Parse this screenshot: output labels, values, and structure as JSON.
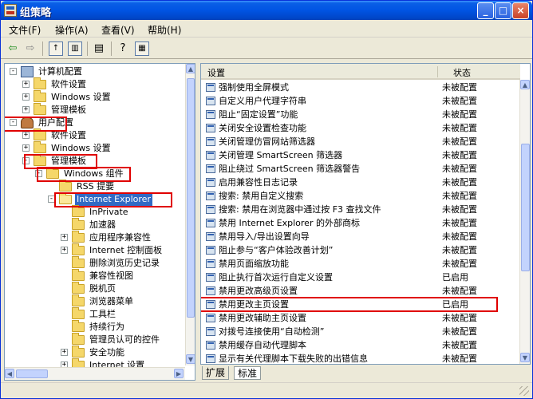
{
  "window": {
    "title": "组策略"
  },
  "menu": [
    "文件(F)",
    "操作(A)",
    "查看(V)",
    "帮助(H)"
  ],
  "tree": [
    {
      "label": "计算机配置",
      "indent": 0,
      "icon": "computer-icon",
      "exp": "−",
      "name": "tree-item-computer-config"
    },
    {
      "label": "软件设置",
      "indent": 1,
      "icon": "folder-icon",
      "exp": "+",
      "name": "tree-item-software-settings"
    },
    {
      "label": "Windows 设置",
      "indent": 1,
      "icon": "folder-icon",
      "exp": "+",
      "name": "tree-item-windows-settings"
    },
    {
      "label": "管理模板",
      "indent": 1,
      "icon": "folder-icon",
      "exp": "+",
      "name": "tree-item-admin-templates"
    },
    {
      "label": "用户配置",
      "indent": 0,
      "icon": "user-icon",
      "exp": "−",
      "name": "tree-item-user-config"
    },
    {
      "label": "软件设置",
      "indent": 1,
      "icon": "folder-icon",
      "exp": "+",
      "name": "tree-item-user-software-settings"
    },
    {
      "label": "Windows 设置",
      "indent": 1,
      "icon": "folder-icon",
      "exp": "+",
      "name": "tree-item-user-windows-settings"
    },
    {
      "label": "管理模板",
      "indent": 1,
      "icon": "folder-icon",
      "exp": "−",
      "name": "tree-item-user-admin-templates"
    },
    {
      "label": "Windows 组件",
      "indent": 2,
      "icon": "folder-icon",
      "exp": "−",
      "name": "tree-item-windows-components"
    },
    {
      "label": "RSS 提要",
      "indent": 3,
      "icon": "folder-icon",
      "exp": "",
      "name": "tree-item-rss"
    },
    {
      "label": "Internet Explorer",
      "indent": 3,
      "icon": "folder-open-icon",
      "exp": "−",
      "name": "tree-item-internet-explorer",
      "selected": true
    },
    {
      "label": "InPrivate",
      "indent": 4,
      "icon": "folder-icon",
      "exp": "",
      "name": "tree-item-inprivate"
    },
    {
      "label": "加速器",
      "indent": 4,
      "icon": "folder-icon",
      "exp": "",
      "name": "tree-item-accelerators"
    },
    {
      "label": "应用程序兼容性",
      "indent": 4,
      "icon": "folder-icon",
      "exp": "+",
      "name": "tree-item-app-compat"
    },
    {
      "label": "Internet 控制面板",
      "indent": 4,
      "icon": "folder-icon",
      "exp": "+",
      "name": "tree-item-internet-control-panel"
    },
    {
      "label": "删除浏览历史记录",
      "indent": 4,
      "icon": "folder-icon",
      "exp": "",
      "name": "tree-item-delete-history"
    },
    {
      "label": "兼容性视图",
      "indent": 4,
      "icon": "folder-icon",
      "exp": "",
      "name": "tree-item-compat-view"
    },
    {
      "label": "脱机页",
      "indent": 4,
      "icon": "folder-icon",
      "exp": "",
      "name": "tree-item-offline-pages"
    },
    {
      "label": "浏览器菜单",
      "indent": 4,
      "icon": "folder-icon",
      "exp": "",
      "name": "tree-item-browser-menus"
    },
    {
      "label": "工具栏",
      "indent": 4,
      "icon": "folder-icon",
      "exp": "",
      "name": "tree-item-toolbars"
    },
    {
      "label": "持续行为",
      "indent": 4,
      "icon": "folder-icon",
      "exp": "",
      "name": "tree-item-persistence"
    },
    {
      "label": "管理员认可的控件",
      "indent": 4,
      "icon": "folder-icon",
      "exp": "",
      "name": "tree-item-admin-approved-controls"
    },
    {
      "label": "安全功能",
      "indent": 4,
      "icon": "folder-icon",
      "exp": "+",
      "name": "tree-item-security-features"
    },
    {
      "label": "Internet 设置",
      "indent": 4,
      "icon": "folder-icon",
      "exp": "+",
      "name": "tree-item-internet-settings"
    }
  ],
  "list": {
    "headers": {
      "setting": "设置",
      "state": "状态"
    },
    "rows": [
      {
        "name": "强制使用全屏模式",
        "state": "未被配置"
      },
      {
        "name": "自定义用户代理字符串",
        "state": "未被配置"
      },
      {
        "name": "阻止“固定设置”功能",
        "state": "未被配置"
      },
      {
        "name": "关闭安全设置检查功能",
        "state": "未被配置"
      },
      {
        "name": "关闭管理仿冒网站筛选器",
        "state": "未被配置"
      },
      {
        "name": "关闭管理 SmartScreen 筛选器",
        "state": "未被配置"
      },
      {
        "name": "阻止绕过 SmartScreen 筛选器警告",
        "state": "未被配置"
      },
      {
        "name": "启用兼容性日志记录",
        "state": "未被配置"
      },
      {
        "name": "搜索: 禁用自定义搜索",
        "state": "未被配置"
      },
      {
        "name": "搜索: 禁用在浏览器中通过按 F3 查找文件",
        "state": "未被配置"
      },
      {
        "name": "禁用 Internet Explorer 的外部商标",
        "state": "未被配置"
      },
      {
        "name": "禁用导入/导出设置向导",
        "state": "未被配置"
      },
      {
        "name": "阻止参与“客户体验改善计划”",
        "state": "未被配置"
      },
      {
        "name": "禁用页面缩放功能",
        "state": "未被配置"
      },
      {
        "name": "阻止执行首次运行自定义设置",
        "state": "已启用"
      },
      {
        "name": "禁用更改高级页设置",
        "state": "未被配置"
      },
      {
        "name": "禁用更改主页设置",
        "state": "已启用",
        "highlighted": true
      },
      {
        "name": "禁用更改辅助主页设置",
        "state": "未被配置"
      },
      {
        "name": "对拨号连接使用“自动检测”",
        "state": "未被配置"
      },
      {
        "name": "禁用缓存自动代理脚本",
        "state": "未被配置"
      },
      {
        "name": "显示有关代理脚本下载失败的出错信息",
        "state": "未被配置"
      }
    ]
  },
  "tabs": [
    "扩展",
    "标准"
  ]
}
